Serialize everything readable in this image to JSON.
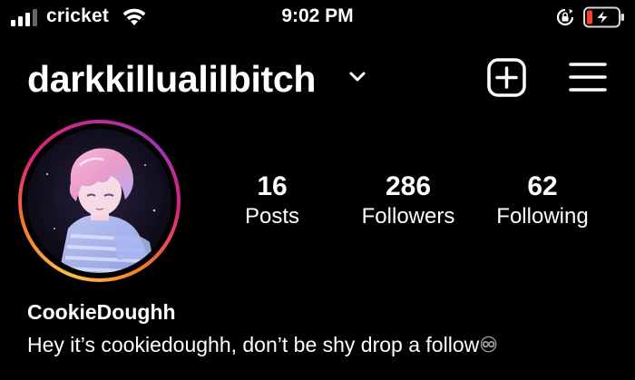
{
  "status_bar": {
    "carrier": "cricket",
    "time": "9:02 PM"
  },
  "profile": {
    "username": "darkkillualilbitch",
    "display_name": "CookieDoughh",
    "bio": "Hey it’s cookiedoughh, don’t be shy drop a follow",
    "bio_emoji": "♾"
  },
  "stats": {
    "posts": {
      "count": "16",
      "label": "Posts"
    },
    "followers": {
      "count": "286",
      "label": "Followers"
    },
    "following": {
      "count": "62",
      "label": "Following"
    }
  },
  "icons": {
    "cellular": "signal-bars-icon",
    "wifi": "wifi-icon",
    "orientation": "rotation-lock-icon",
    "battery": "battery-charging-icon",
    "dropdown": "chevron-down-icon",
    "create": "plus-square-icon",
    "menu": "hamburger-menu-icon"
  },
  "colors": {
    "background": "#000000",
    "text": "#ffffff",
    "battery_low": "#ff3b30",
    "story_ring": [
      "#fbc14e",
      "#f77b2a",
      "#d9247a",
      "#9b36b8"
    ]
  }
}
